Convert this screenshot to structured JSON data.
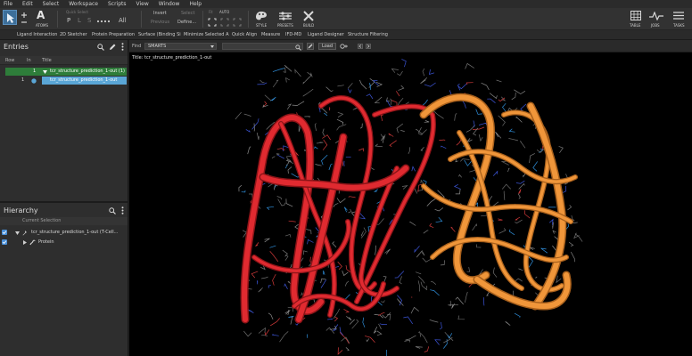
{
  "menu": [
    "File",
    "Edit",
    "Select",
    "Workspace",
    "Scripts",
    "View",
    "Window",
    "Help"
  ],
  "ribbon": {
    "atoms_label": "ATOMS",
    "quick_select": "Quick Select",
    "quick_letters": [
      "P",
      "L",
      "S"
    ],
    "all_label": "All",
    "invert": "Invert",
    "previous": "Previous",
    "select": "Select",
    "define": "Define...",
    "fit_label": "Fit",
    "auto_label": "AUTO",
    "style": "STYLE",
    "presets": "PRESETS",
    "build": "BUILD",
    "table": "TABLE",
    "jobs": "JOBS",
    "tasks": "TASKS"
  },
  "workflows": [
    "Ligand Interaction",
    "2D Sketcher",
    "Protein Preparation",
    "Surface (Binding Si",
    "Minimize Selected A",
    "Quick Align",
    "Measure",
    "IFD-MD",
    "Ligand Designer",
    "Structure Filtering"
  ],
  "entries": {
    "title": "Entries",
    "columns": [
      "Row",
      "In",
      "Title"
    ],
    "group": {
      "row": "1",
      "title": "tcr_structure_prediction_1-out (1)"
    },
    "entry": {
      "row": "1",
      "title": "tcr_structure_prediction_1-out"
    }
  },
  "hierarchy": {
    "title": "Hierarchy",
    "current_selection": "Current Selection",
    "root": "tcr_structure_prediction_1-out (T-Cell...",
    "child": "Protein"
  },
  "workspace": {
    "find_label": "Find",
    "find_mode": "SMARTS",
    "load_label": "Load",
    "title": "Title: tcr_structure_prediction_1-out"
  },
  "colors": {
    "chain_a": "#e02a30",
    "chain_b": "#f0963a",
    "selected_entry": "#5aa6d6",
    "group_row": "#2e7d3a"
  }
}
